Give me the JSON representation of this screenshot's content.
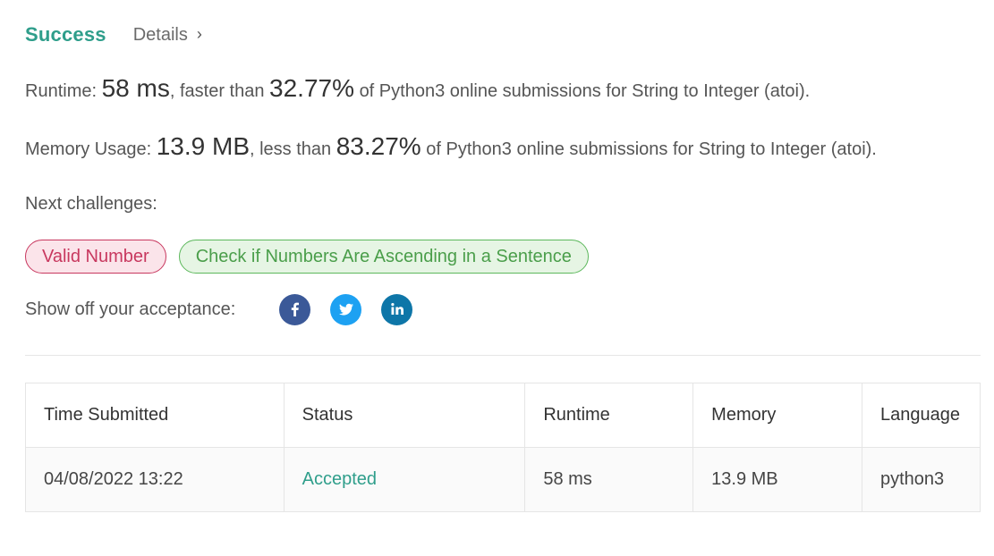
{
  "header": {
    "status": "Success",
    "details_label": "Details",
    "details_chevron": "›"
  },
  "runtime": {
    "label": "Runtime:",
    "value": "58 ms",
    "comparison": ", faster than",
    "percent": "32.77%",
    "suffix": "of Python3 online submissions for String to Integer (atoi)."
  },
  "memory": {
    "label": "Memory Usage:",
    "value": "13.9 MB",
    "comparison": ", less than",
    "percent": "83.27%",
    "suffix": "of Python3 online submissions for String to Integer (atoi)."
  },
  "next_challenges": {
    "label": "Next challenges:",
    "items": [
      {
        "label": "Valid Number",
        "difficulty": "hard",
        "color": "#c8385f"
      },
      {
        "label": "Check if Numbers Are Ascending in a Sentence",
        "difficulty": "easy",
        "color": "#5cb85c"
      }
    ]
  },
  "share": {
    "label": "Show off your acceptance:",
    "icons": [
      "facebook-icon",
      "twitter-icon",
      "linkedin-icon"
    ]
  },
  "table": {
    "headers": [
      "Time Submitted",
      "Status",
      "Runtime",
      "Memory",
      "Language"
    ],
    "rows": [
      [
        "04/08/2022 13:22",
        "Accepted",
        "58 ms",
        "13.9 MB",
        "python3"
      ]
    ]
  },
  "colors": {
    "success": "#2f9e8b",
    "hard": "#c8385f",
    "easy": "#5cb85c"
  }
}
